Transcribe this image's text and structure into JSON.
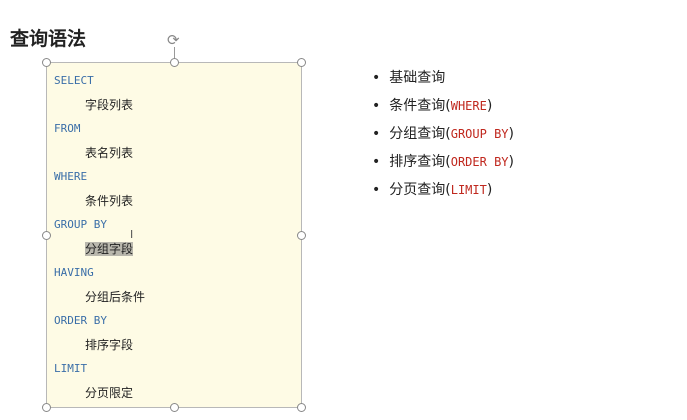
{
  "title": "查询语法",
  "code": [
    {
      "kw": "SELECT",
      "val": "字段列表"
    },
    {
      "kw": "FROM",
      "val": "表名列表"
    },
    {
      "kw": "WHERE",
      "val": "条件列表"
    },
    {
      "kw": "GROUP BY",
      "val": "分组字段"
    },
    {
      "kw": "HAVING",
      "val": "分组后条件"
    },
    {
      "kw": "ORDER BY",
      "val": "排序字段"
    },
    {
      "kw": "LIMIT",
      "val": "分页限定"
    }
  ],
  "bullets": [
    {
      "text": "基础查询",
      "kw": ""
    },
    {
      "text": "条件查询(",
      "kw": "WHERE",
      "end": ")"
    },
    {
      "text": "分组查询(",
      "kw": "GROUP BY",
      "end": ")"
    },
    {
      "text": "排序查询(",
      "kw": "ORDER BY",
      "end": ")"
    },
    {
      "text": "分页查询(",
      "kw": "LIMIT",
      "end": ")"
    }
  ]
}
